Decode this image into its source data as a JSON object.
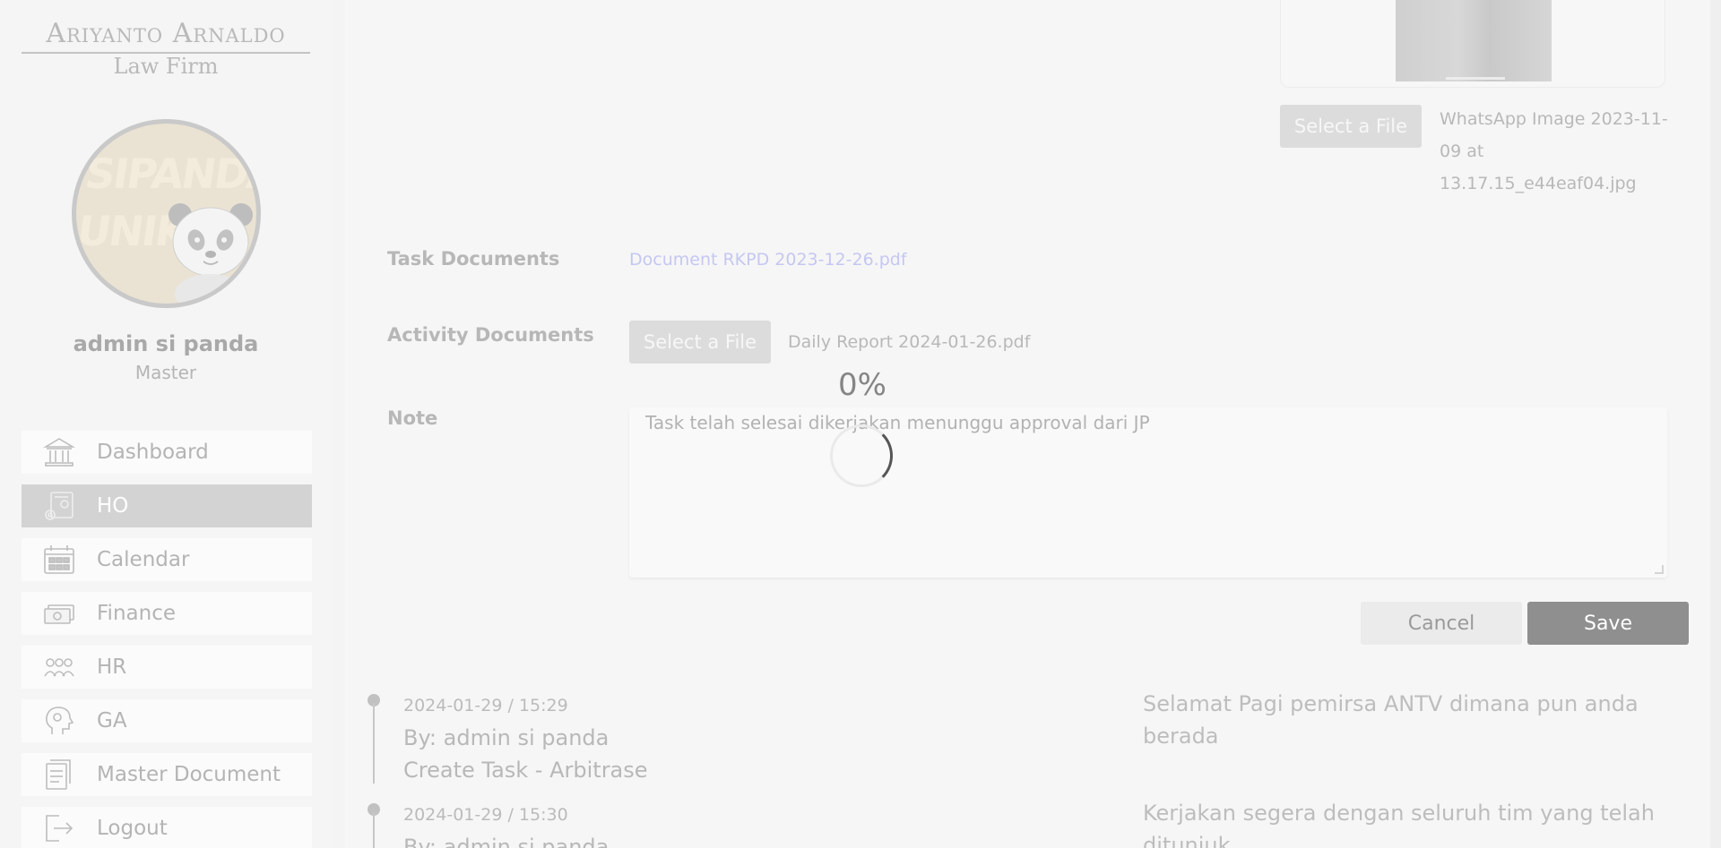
{
  "sidebar": {
    "logo": {
      "line1": "Ariyanto Arnaldo",
      "line2": "Law Firm"
    },
    "avatar": {
      "text_line1": "SIPANDA",
      "text_line2": "UNIK"
    },
    "user": {
      "name": "admin si panda",
      "role": "Master"
    },
    "items": [
      {
        "label": "Dashboard",
        "icon": "bank-icon",
        "active": false
      },
      {
        "label": "HO",
        "icon": "office-icon",
        "active": true
      },
      {
        "label": "Calendar",
        "icon": "calendar-icon",
        "active": false
      },
      {
        "label": "Finance",
        "icon": "money-icon",
        "active": false
      },
      {
        "label": "HR",
        "icon": "people-icon",
        "active": false
      },
      {
        "label": "GA",
        "icon": "head-gear-icon",
        "active": false
      },
      {
        "label": "Master Document",
        "icon": "document-icon",
        "active": false
      },
      {
        "label": "Logout",
        "icon": "logout-icon",
        "active": false
      }
    ]
  },
  "image_upload": {
    "button_label": "Select a File",
    "file_name": "WhatsApp Image 2023-11-09 at 13.17.15_e44eaf04.jpg"
  },
  "form": {
    "task_documents": {
      "label": "Task Documents",
      "link": "Document RKPD 2023-12-26.pdf"
    },
    "activity_documents": {
      "label": "Activity Documents",
      "button_label": "Select a File",
      "file_name": "Daily Report 2024-01-26.pdf"
    },
    "note": {
      "label": "Note",
      "value": "Task telah selesai dikerjakan menunggu approval dari JP"
    },
    "upload_progress": "0%",
    "cancel_label": "Cancel",
    "save_label": "Save"
  },
  "timeline": [
    {
      "datetime": "2024-01-29 / 15:29",
      "by": "By: admin si panda",
      "action": "Create Task - Arbitrase",
      "message": "Selamat Pagi pemirsa ANTV dimana pun anda berada"
    },
    {
      "datetime": "2024-01-29 / 15:30",
      "by": "By: admin si panda",
      "message": "Kerjakan segera dengan seluruh tim yang telah ditunjuk"
    }
  ],
  "colors": {
    "active_nav": "#d3d3d3",
    "save_button": "#8f8f8f",
    "link": "#c5c7f2"
  }
}
